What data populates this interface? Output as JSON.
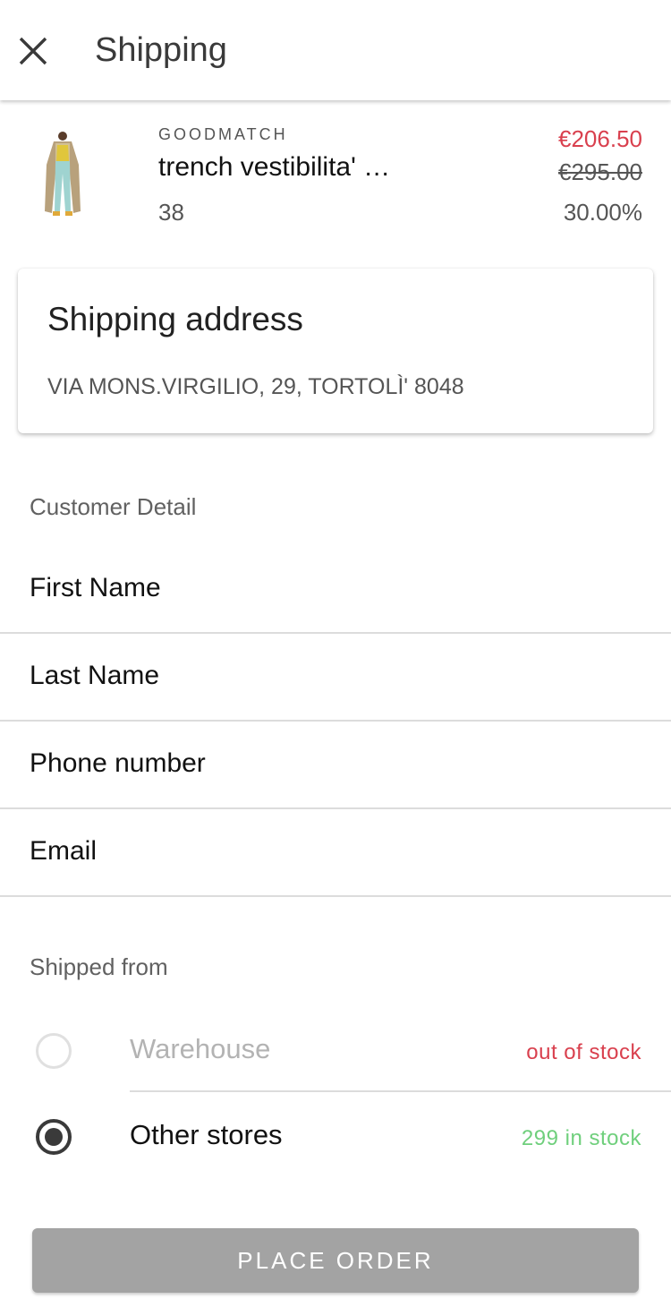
{
  "header": {
    "close_icon": "close-icon",
    "title": "Shipping"
  },
  "product": {
    "image": "trench-coat-model-image",
    "brand": "GOODMATCH",
    "name": "trench vestibilita' …",
    "size": "38",
    "sale_price": "€206.50",
    "original_price": "€295.00",
    "discount": "30.00%"
  },
  "shipping_address": {
    "title": "Shipping address",
    "address": "VIA MONS.VIRGILIO, 29, TORTOLÌ' 8048"
  },
  "customer_detail": {
    "section_label": "Customer Detail",
    "fields": [
      {
        "label": "First Name"
      },
      {
        "label": "Last Name"
      },
      {
        "label": "Phone number"
      },
      {
        "label": "Email"
      }
    ]
  },
  "shipped_from": {
    "section_label": "Shipped from",
    "options": [
      {
        "label": "Warehouse",
        "stock": "out of stock",
        "selected": false,
        "enabled": false
      },
      {
        "label": "Other stores",
        "stock": "299 in stock",
        "selected": true,
        "enabled": true
      }
    ]
  },
  "actions": {
    "place_order": "PLACE ORDER"
  },
  "colors": {
    "sale_price": "#d9404e",
    "in_stock": "#6fcf7c",
    "out_of_stock": "#d9404e",
    "button_disabled": "#a3a3a3"
  }
}
